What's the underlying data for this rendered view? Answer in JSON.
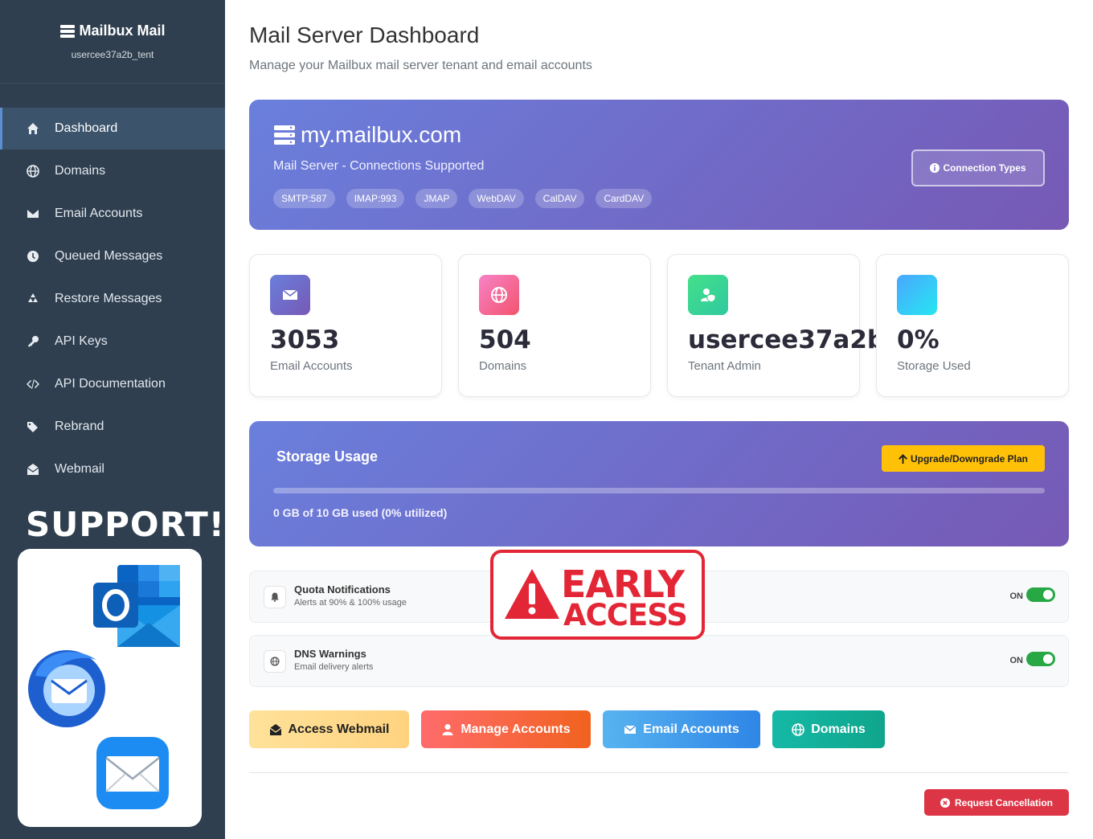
{
  "sidebar": {
    "brand_title": "Mailbux Mail",
    "brand_sub": "usercee37a2b_tent",
    "items": [
      {
        "label": "Dashboard",
        "icon": "home-icon"
      },
      {
        "label": "Domains",
        "icon": "globe-icon"
      },
      {
        "label": "Email Accounts",
        "icon": "envelope-icon"
      },
      {
        "label": "Queued Messages",
        "icon": "clock-icon"
      },
      {
        "label": "Restore Messages",
        "icon": "recycle-icon"
      },
      {
        "label": "API Keys",
        "icon": "key-icon"
      },
      {
        "label": "API Documentation",
        "icon": "code-icon"
      },
      {
        "label": "Rebrand",
        "icon": "tags-icon"
      },
      {
        "label": "Webmail",
        "icon": "envelope-open-icon"
      }
    ],
    "active_item": "Dashboard",
    "support_text": "SUPPORT!",
    "client_logos": [
      "outlook-logo",
      "thunderbird-logo",
      "apple-mail-logo"
    ]
  },
  "header": {
    "title": "Mail Server Dashboard",
    "subtitle": "Manage your Mailbux mail server tenant and email accounts"
  },
  "server": {
    "hostname": "my.mailbux.com",
    "subtitle": "Mail Server - Connections Supported",
    "protocols": [
      "SMTP:587",
      "IMAP:993",
      "JMAP",
      "WebDAV",
      "CalDAV",
      "CardDAV"
    ],
    "connection_button": "Connection Types"
  },
  "stats": [
    {
      "value": "3053",
      "label": "Email Accounts",
      "icon": "envelope-icon",
      "color": "#6a5acd"
    },
    {
      "value": "504",
      "label": "Domains",
      "icon": "globe-icon",
      "color": "#f06fb0"
    },
    {
      "value": "usercee37a2b",
      "label": "Tenant Admin",
      "icon": "user-shield-icon",
      "color": "#38d17c"
    },
    {
      "value": "0%",
      "label": "Storage Used",
      "icon": "database-icon",
      "color": "#2fc6f5"
    }
  ],
  "storage": {
    "title": "Storage Usage",
    "upgrade_button": "Upgrade/Downgrade Plan",
    "used_fraction": 0,
    "summary": "0 GB of 10 GB used (0% utilized)"
  },
  "notifications": [
    {
      "title": "Quota Notifications",
      "sub": "Alerts at 90% & 100% usage",
      "state": "ON",
      "icon": "bell-icon"
    },
    {
      "title": "DNS Warnings",
      "sub": "Email delivery alerts",
      "state": "ON",
      "icon": "globe-icon"
    }
  ],
  "badge": {
    "line1": "EARLY",
    "line2": "ACCESS"
  },
  "actions": [
    {
      "label": "Access Webmail",
      "icon": "envelope-open-icon"
    },
    {
      "label": "Manage Accounts",
      "icon": "user-icon"
    },
    {
      "label": "Email Accounts",
      "icon": "envelope-icon"
    },
    {
      "label": "Domains",
      "icon": "globe-icon"
    }
  ],
  "cancel_button": "Request Cancellation",
  "colors": {
    "sidebar": "#2f3f4f",
    "accent": "#6a7fdc",
    "danger": "#dc3545",
    "warning": "#ffc107",
    "success": "#28a745"
  }
}
